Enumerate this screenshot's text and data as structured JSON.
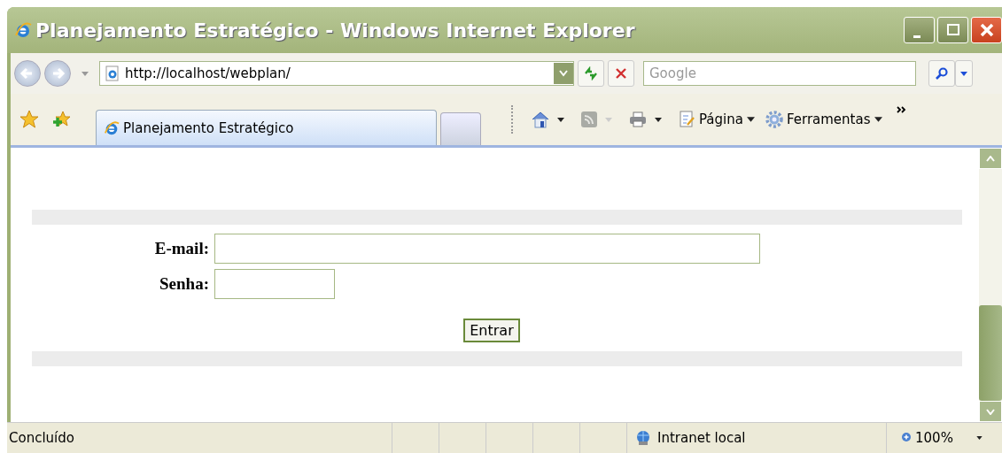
{
  "window": {
    "title": "Planejamento Estratégico - Windows Internet Explorer"
  },
  "address_bar": {
    "url": "http://localhost/webplan/"
  },
  "search": {
    "placeholder": "Google"
  },
  "tab": {
    "label": "Planejamento Estratégico",
    "selected": true
  },
  "toolbar": {
    "items": [
      {
        "kind": "home"
      },
      {
        "kind": "feeds"
      },
      {
        "kind": "print"
      },
      {
        "kind": "page",
        "label": "Página"
      },
      {
        "kind": "tools",
        "label": "Ferramentas"
      }
    ]
  },
  "form": {
    "fields": [
      {
        "label": "E-mail:",
        "kind": "wide"
      },
      {
        "label": "Senha:",
        "kind": "narrow"
      }
    ],
    "submit": "Entrar"
  },
  "status_bar": {
    "text": "Concluído",
    "zone": "Intranet local",
    "zoom": "100%"
  }
}
